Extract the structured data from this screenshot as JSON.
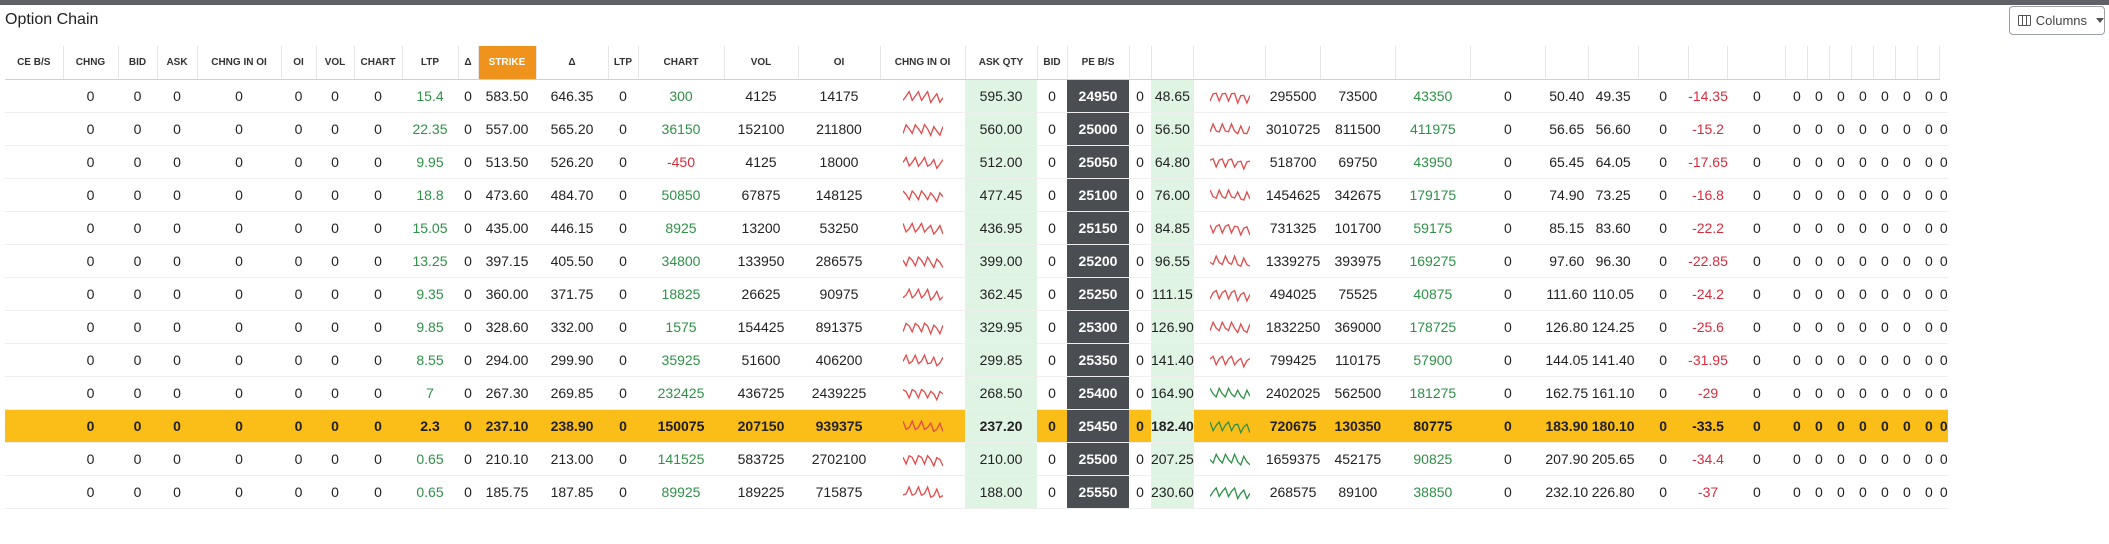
{
  "title": "Option Chain",
  "columns_button": {
    "label": "Columns",
    "icon": "columns-icon"
  },
  "colors": {
    "accent_strike": "#f0931d",
    "atm_row": "#fbbd18",
    "strike_cell": "#4a4d52",
    "positive": "#2e9147",
    "negative": "#d62c3c",
    "highlight_cell": "#dff4e3"
  },
  "headers": [
    "CE B/S",
    "CHNG",
    "BID",
    "ASK",
    "CHNG IN OI",
    "OI",
    "VOL",
    "CHART",
    "LTP",
    "Δ",
    "STRIKE",
    "Δ",
    "LTP",
    "CHART",
    "VOL",
    "OI",
    "CHNG IN OI",
    "ASK QTY",
    "BID",
    "PE B/S",
    "",
    "",
    "",
    "",
    "",
    "",
    "",
    "",
    "",
    "",
    "",
    "",
    "",
    "",
    "",
    "",
    "",
    "",
    ""
  ],
  "rows": [
    {
      "ce": [
        "0",
        "0",
        "0",
        "0",
        "0",
        "0",
        "0",
        "15.4",
        "0",
        "583.50"
      ],
      "delta": "646.35",
      "ltp": "0",
      "chart": "300",
      "vol": "4125",
      "oi": "14175",
      "spark": "red",
      "ask_qty": "595.30",
      "bid": "0",
      "strike": "24950",
      "z": "0",
      "pe_ltp": "48.65",
      "pe_spark": "red",
      "pe_vol": "295500",
      "pe_oi": "73500",
      "pe_chng": "43350",
      "pe_a": "0",
      "pe_b": "50.40",
      "pe_c": "49.35",
      "pe_d": "0",
      "pe_chg": "-14.35"
    },
    {
      "ce": [
        "0",
        "0",
        "0",
        "0",
        "0",
        "0",
        "0",
        "22.35",
        "0",
        "557.00"
      ],
      "delta": "565.20",
      "ltp": "0",
      "chart": "36150",
      "vol": "152100",
      "oi": "211800",
      "spark": "red",
      "ask_qty": "560.00",
      "bid": "0",
      "strike": "25000",
      "z": "0",
      "pe_ltp": "56.50",
      "pe_spark": "red",
      "pe_vol": "3010725",
      "pe_oi": "811500",
      "pe_chng": "411975",
      "pe_a": "0",
      "pe_b": "56.65",
      "pe_c": "56.60",
      "pe_d": "0",
      "pe_chg": "-15.2"
    },
    {
      "ce": [
        "0",
        "0",
        "0",
        "0",
        "0",
        "0",
        "0",
        "9.95",
        "0",
        "513.50"
      ],
      "delta": "526.20",
      "ltp": "0",
      "chart": "-450",
      "vol": "4125",
      "oi": "18000",
      "spark": "red",
      "ask_qty": "512.00",
      "bid": "0",
      "strike": "25050",
      "z": "0",
      "pe_ltp": "64.80",
      "pe_spark": "red",
      "pe_vol": "518700",
      "pe_oi": "69750",
      "pe_chng": "43950",
      "pe_a": "0",
      "pe_b": "65.45",
      "pe_c": "64.05",
      "pe_d": "0",
      "pe_chg": "-17.65"
    },
    {
      "ce": [
        "0",
        "0",
        "0",
        "0",
        "0",
        "0",
        "0",
        "18.8",
        "0",
        "473.60"
      ],
      "delta": "484.70",
      "ltp": "0",
      "chart": "50850",
      "vol": "67875",
      "oi": "148125",
      "spark": "red",
      "ask_qty": "477.45",
      "bid": "0",
      "strike": "25100",
      "z": "0",
      "pe_ltp": "76.00",
      "pe_spark": "red",
      "pe_vol": "1454625",
      "pe_oi": "342675",
      "pe_chng": "179175",
      "pe_a": "0",
      "pe_b": "74.90",
      "pe_c": "73.25",
      "pe_d": "0",
      "pe_chg": "-16.8"
    },
    {
      "ce": [
        "0",
        "0",
        "0",
        "0",
        "0",
        "0",
        "0",
        "15.05",
        "0",
        "435.00"
      ],
      "delta": "446.15",
      "ltp": "0",
      "chart": "8925",
      "vol": "13200",
      "oi": "53250",
      "spark": "red",
      "ask_qty": "436.95",
      "bid": "0",
      "strike": "25150",
      "z": "0",
      "pe_ltp": "84.85",
      "pe_spark": "red",
      "pe_vol": "731325",
      "pe_oi": "101700",
      "pe_chng": "59175",
      "pe_a": "0",
      "pe_b": "85.15",
      "pe_c": "83.60",
      "pe_d": "0",
      "pe_chg": "-22.2"
    },
    {
      "ce": [
        "0",
        "0",
        "0",
        "0",
        "0",
        "0",
        "0",
        "13.25",
        "0",
        "397.15"
      ],
      "delta": "405.50",
      "ltp": "0",
      "chart": "34800",
      "vol": "133950",
      "oi": "286575",
      "spark": "red",
      "ask_qty": "399.00",
      "bid": "0",
      "strike": "25200",
      "z": "0",
      "pe_ltp": "96.55",
      "pe_spark": "red",
      "pe_vol": "1339275",
      "pe_oi": "393975",
      "pe_chng": "169275",
      "pe_a": "0",
      "pe_b": "97.60",
      "pe_c": "96.30",
      "pe_d": "0",
      "pe_chg": "-22.85"
    },
    {
      "ce": [
        "0",
        "0",
        "0",
        "0",
        "0",
        "0",
        "0",
        "9.35",
        "0",
        "360.00"
      ],
      "delta": "371.75",
      "ltp": "0",
      "chart": "18825",
      "vol": "26625",
      "oi": "90975",
      "spark": "red",
      "ask_qty": "362.45",
      "bid": "0",
      "strike": "25250",
      "z": "0",
      "pe_ltp": "111.15",
      "pe_spark": "red",
      "pe_vol": "494025",
      "pe_oi": "75525",
      "pe_chng": "40875",
      "pe_a": "0",
      "pe_b": "111.60",
      "pe_c": "110.05",
      "pe_d": "0",
      "pe_chg": "-24.2"
    },
    {
      "ce": [
        "0",
        "0",
        "0",
        "0",
        "0",
        "0",
        "0",
        "9.85",
        "0",
        "328.60"
      ],
      "delta": "332.00",
      "ltp": "0",
      "chart": "1575",
      "vol": "154425",
      "oi": "891375",
      "spark": "red",
      "ask_qty": "329.95",
      "bid": "0",
      "strike": "25300",
      "z": "0",
      "pe_ltp": "126.90",
      "pe_spark": "red",
      "pe_vol": "1832250",
      "pe_oi": "369000",
      "pe_chng": "178725",
      "pe_a": "0",
      "pe_b": "126.80",
      "pe_c": "124.25",
      "pe_d": "0",
      "pe_chg": "-25.6"
    },
    {
      "ce": [
        "0",
        "0",
        "0",
        "0",
        "0",
        "0",
        "0",
        "8.55",
        "0",
        "294.00"
      ],
      "delta": "299.90",
      "ltp": "0",
      "chart": "35925",
      "vol": "51600",
      "oi": "406200",
      "spark": "red",
      "ask_qty": "299.85",
      "bid": "0",
      "strike": "25350",
      "z": "0",
      "pe_ltp": "141.40",
      "pe_spark": "red",
      "pe_vol": "799425",
      "pe_oi": "110175",
      "pe_chng": "57900",
      "pe_a": "0",
      "pe_b": "144.05",
      "pe_c": "141.40",
      "pe_d": "0",
      "pe_chg": "-31.95"
    },
    {
      "ce": [
        "0",
        "0",
        "0",
        "0",
        "0",
        "0",
        "0",
        "7",
        "0",
        "267.30"
      ],
      "delta": "269.85",
      "ltp": "0",
      "chart": "232425",
      "vol": "436725",
      "oi": "2439225",
      "spark": "red",
      "ask_qty": "268.50",
      "bid": "0",
      "strike": "25400",
      "z": "0",
      "pe_ltp": "164.90",
      "pe_spark": "green",
      "pe_vol": "2402025",
      "pe_oi": "562500",
      "pe_chng": "181275",
      "pe_a": "0",
      "pe_b": "162.75",
      "pe_c": "161.10",
      "pe_d": "0",
      "pe_chg": "-29"
    },
    {
      "atm": true,
      "ce": [
        "0",
        "0",
        "0",
        "0",
        "0",
        "0",
        "0",
        "2.3",
        "0",
        "237.10"
      ],
      "delta": "238.90",
      "ltp": "0",
      "chart": "150075",
      "vol": "207150",
      "oi": "939375",
      "spark": "red",
      "ask_qty": "237.20",
      "bid": "0",
      "strike": "25450",
      "z": "0",
      "pe_ltp": "182.40",
      "pe_spark": "green",
      "pe_vol": "720675",
      "pe_oi": "130350",
      "pe_chng": "80775",
      "pe_a": "0",
      "pe_b": "183.90",
      "pe_c": "180.10",
      "pe_d": "0",
      "pe_chg": "-33.5"
    },
    {
      "ce": [
        "0",
        "0",
        "0",
        "0",
        "0",
        "0",
        "0",
        "0.65",
        "0",
        "210.10"
      ],
      "delta": "213.00",
      "ltp": "0",
      "chart": "141525",
      "vol": "583725",
      "oi": "2702100",
      "spark": "red",
      "ask_qty": "210.00",
      "bid": "0",
      "strike": "25500",
      "z": "0",
      "pe_ltp": "207.25",
      "pe_spark": "green",
      "pe_vol": "1659375",
      "pe_oi": "452175",
      "pe_chng": "90825",
      "pe_a": "0",
      "pe_b": "207.90",
      "pe_c": "205.65",
      "pe_d": "0",
      "pe_chg": "-34.4"
    },
    {
      "ce": [
        "0",
        "0",
        "0",
        "0",
        "0",
        "0",
        "0",
        "0.65",
        "0",
        "185.75"
      ],
      "delta": "187.85",
      "ltp": "0",
      "chart": "89925",
      "vol": "189225",
      "oi": "715875",
      "spark": "red",
      "ask_qty": "188.00",
      "bid": "0",
      "strike": "25550",
      "z": "0",
      "pe_ltp": "230.60",
      "pe_spark": "green",
      "pe_vol": "268575",
      "pe_oi": "89100",
      "pe_chng": "38850",
      "pe_a": "0",
      "pe_b": "232.10",
      "pe_c": "226.80",
      "pe_d": "0",
      "pe_chg": "-37"
    }
  ],
  "tail_zeros": [
    "0",
    "0",
    "0",
    "0",
    "0",
    "0",
    "0",
    "0",
    "0"
  ]
}
